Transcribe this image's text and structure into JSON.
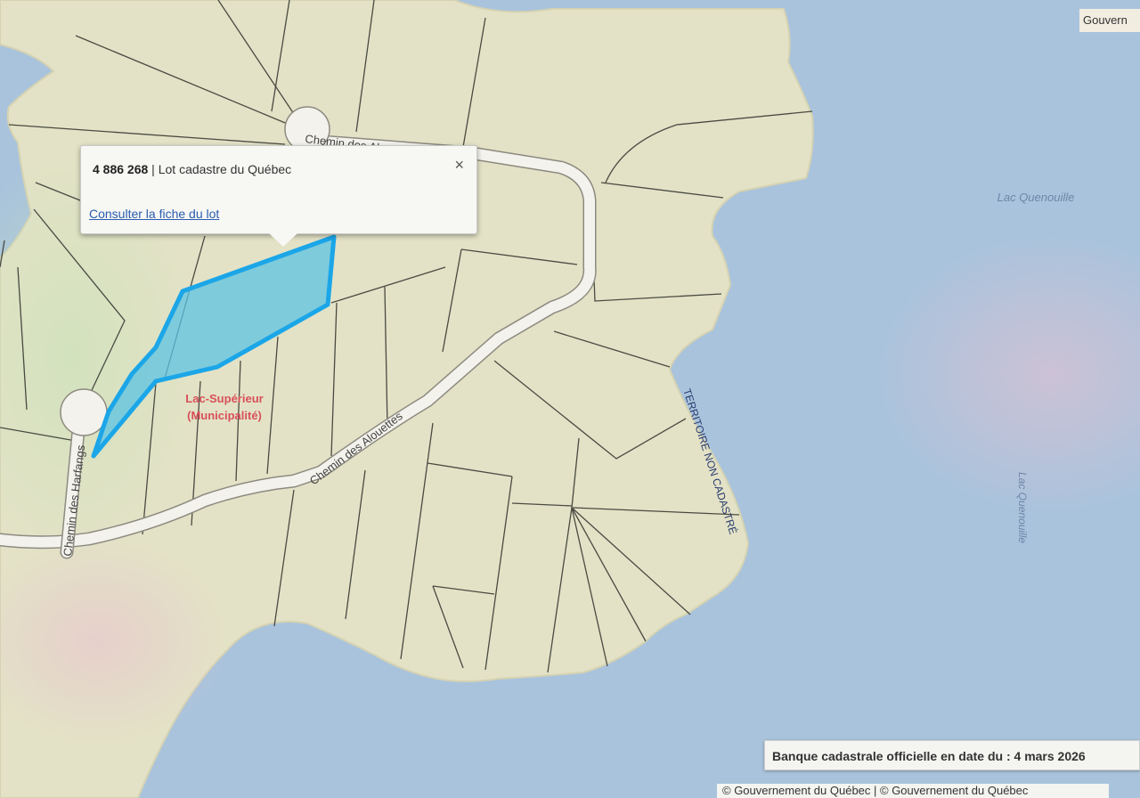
{
  "popup": {
    "lot_number": "4 886 268",
    "lot_type": "Lot cadastre du Québec",
    "separator": " | ",
    "close_symbol": "×",
    "link_text": "Consulter la fiche du lot"
  },
  "map_labels": {
    "chemin_des_alouettes": "Chemin des Alouettes",
    "chemin_des_harfangs": "Chemin des Harfangs",
    "chemin_top": "Chemin des Al",
    "municipality_line1": "Lac-Supérieur",
    "municipality_line2": "(Municipalité)",
    "territoire": "TERRITOIRE NON CADASTRÉ",
    "lac_quenouille_1": "Lac Quenouille",
    "lac_quenouille_2": "Lac Quenouille"
  },
  "date_banner": "Banque cadastrale officielle en date du : 4 mars 2026",
  "copyright": "© Gouvernement du Québec | © Gouvernement du Québec",
  "gov_badge": "Gouvern",
  "colors": {
    "water": "#a9c3dc",
    "land": "#e3e2c6",
    "selection": "#2fb3e8",
    "road": "#f3f2ec",
    "municipality": "#d8505a"
  }
}
